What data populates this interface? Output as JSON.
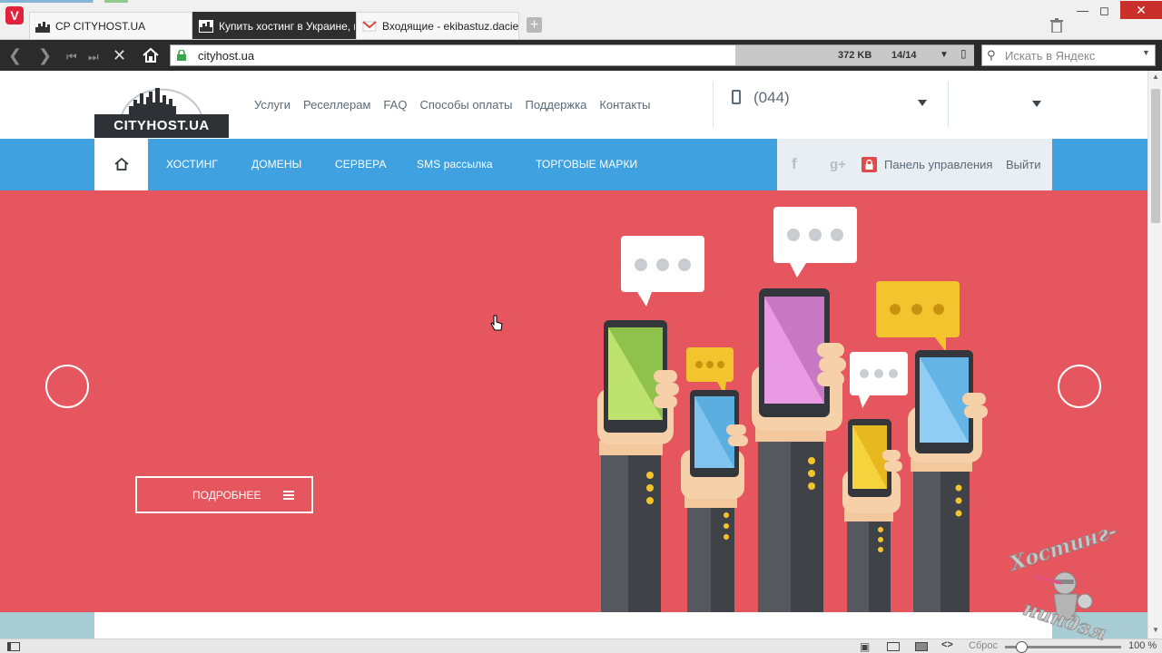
{
  "browser": {
    "tabs": [
      {
        "title": "CP CITYHOST.UA",
        "active": false
      },
      {
        "title": "Купить хостинг в Украине, г",
        "active": true
      },
      {
        "title": "Входящие - ekibastuz.dacie",
        "active": false
      }
    ],
    "url": "cityhost.ua",
    "page_size": "372 KB",
    "load_progress": "14/14",
    "search_placeholder": "Искать в Яндекс",
    "zoom_reset_label": "Сброс",
    "zoom_value": "100 %",
    "zoom_fraction": 0.14
  },
  "site": {
    "logo_text": "CITYHOST.UA",
    "topnav": [
      "Услуги",
      "Реселлерам",
      "FAQ",
      "Способы оплаты",
      "Поддержка",
      "Контакты"
    ],
    "phone": "(044)",
    "mainnav": [
      "Хостинг",
      "Домены",
      "Сервера",
      "SMS рассылка",
      "Торговые марки"
    ],
    "social": [
      "f",
      "g+"
    ],
    "control_panel_label": "Панель управления",
    "logout_label": "Выйти",
    "hero": {
      "more_label": "ПОДРОБНЕЕ",
      "background": "#e5565f"
    },
    "accent_color": "#3fa1e0"
  },
  "watermark": {
    "top_text": "Хостинг-",
    "bottom_text": "ниндзя"
  }
}
